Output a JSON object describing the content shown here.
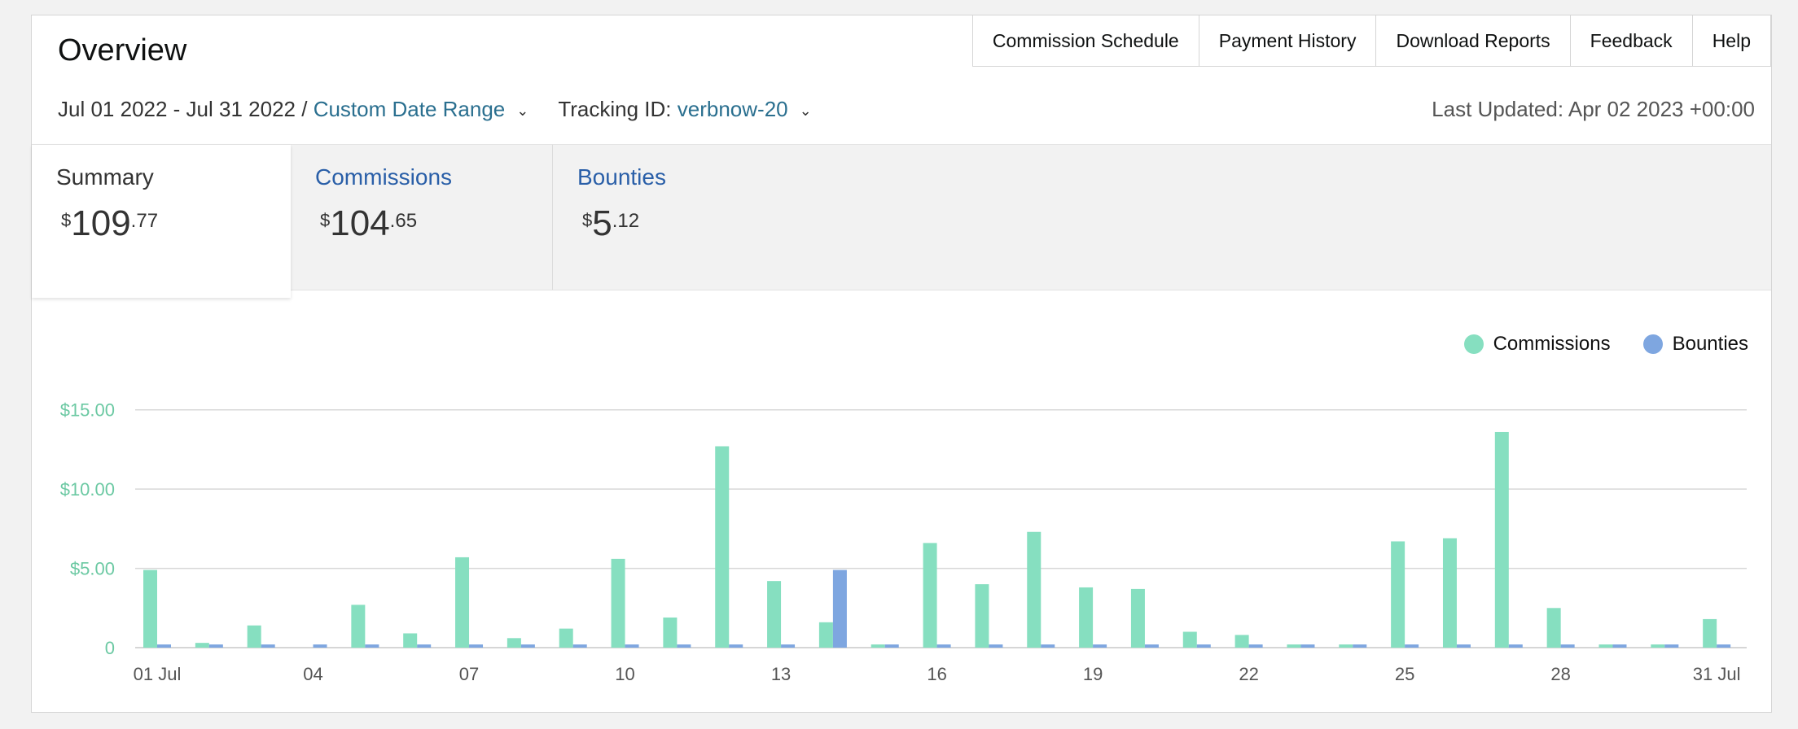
{
  "header": {
    "title": "Overview",
    "nav": [
      "Commission Schedule",
      "Payment History",
      "Download Reports",
      "Feedback",
      "Help"
    ],
    "date_range": "Jul 01 2022 - Jul 31 2022 /",
    "date_range_link": "Custom Date Range",
    "tracking_label": "Tracking ID:",
    "tracking_id": "verbnow-20",
    "last_updated": "Last Updated: Apr 02 2023 +00:00"
  },
  "tabs": {
    "summary": {
      "label": "Summary",
      "currency": "$",
      "dollars": "109",
      "cents": ".77"
    },
    "commissions": {
      "label": "Commissions",
      "currency": "$",
      "dollars": "104",
      "cents": ".65"
    },
    "bounties": {
      "label": "Bounties",
      "currency": "$",
      "dollars": "5",
      "cents": ".12"
    }
  },
  "colors": {
    "commissions": "#86dfc0",
    "bounties": "#7ea6e0",
    "axis_text": "#6cc9a3",
    "grid": "#d8d8d8",
    "caret": "#f2c77a"
  },
  "chart_data": {
    "type": "bar",
    "categories": [
      "01 Jul",
      "02",
      "03",
      "04",
      "05",
      "06",
      "07",
      "08",
      "09",
      "10",
      "11",
      "12",
      "13",
      "14",
      "15",
      "16",
      "17",
      "18",
      "19",
      "20",
      "21",
      "22",
      "23",
      "24",
      "25",
      "26",
      "27",
      "28",
      "29",
      "30",
      "31 Jul"
    ],
    "tick_labels": [
      "01 Jul",
      "04",
      "07",
      "10",
      "13",
      "16",
      "19",
      "22",
      "25",
      "28",
      "31 Jul"
    ],
    "tick_indices": [
      0,
      3,
      6,
      9,
      12,
      15,
      18,
      21,
      24,
      27,
      30
    ],
    "y_ticks": [
      0,
      5,
      10,
      15
    ],
    "y_tick_labels": [
      "0",
      "$5.00",
      "$10.00",
      "$15.00"
    ],
    "ylim": [
      0,
      15.6
    ],
    "series": [
      {
        "name": "Commissions",
        "values": [
          4.9,
          0.3,
          1.4,
          0,
          2.7,
          0.9,
          5.7,
          0.6,
          1.2,
          5.6,
          1.9,
          12.7,
          4.2,
          1.6,
          0.2,
          6.6,
          4.0,
          7.3,
          3.8,
          3.7,
          1.0,
          0.8,
          0.2,
          0.2,
          6.7,
          6.9,
          13.6,
          2.5,
          0.2,
          0.2,
          1.8
        ]
      },
      {
        "name": "Bounties",
        "values": [
          0.2,
          0.2,
          0.2,
          0.2,
          0.2,
          0.2,
          0.2,
          0.2,
          0.2,
          0.2,
          0.2,
          0.2,
          0.2,
          4.9,
          0.2,
          0.2,
          0.2,
          0.2,
          0.2,
          0.2,
          0.2,
          0.2,
          0.2,
          0.2,
          0.2,
          0.2,
          0.2,
          0.2,
          0.2,
          0.2,
          0.2
        ]
      }
    ]
  }
}
